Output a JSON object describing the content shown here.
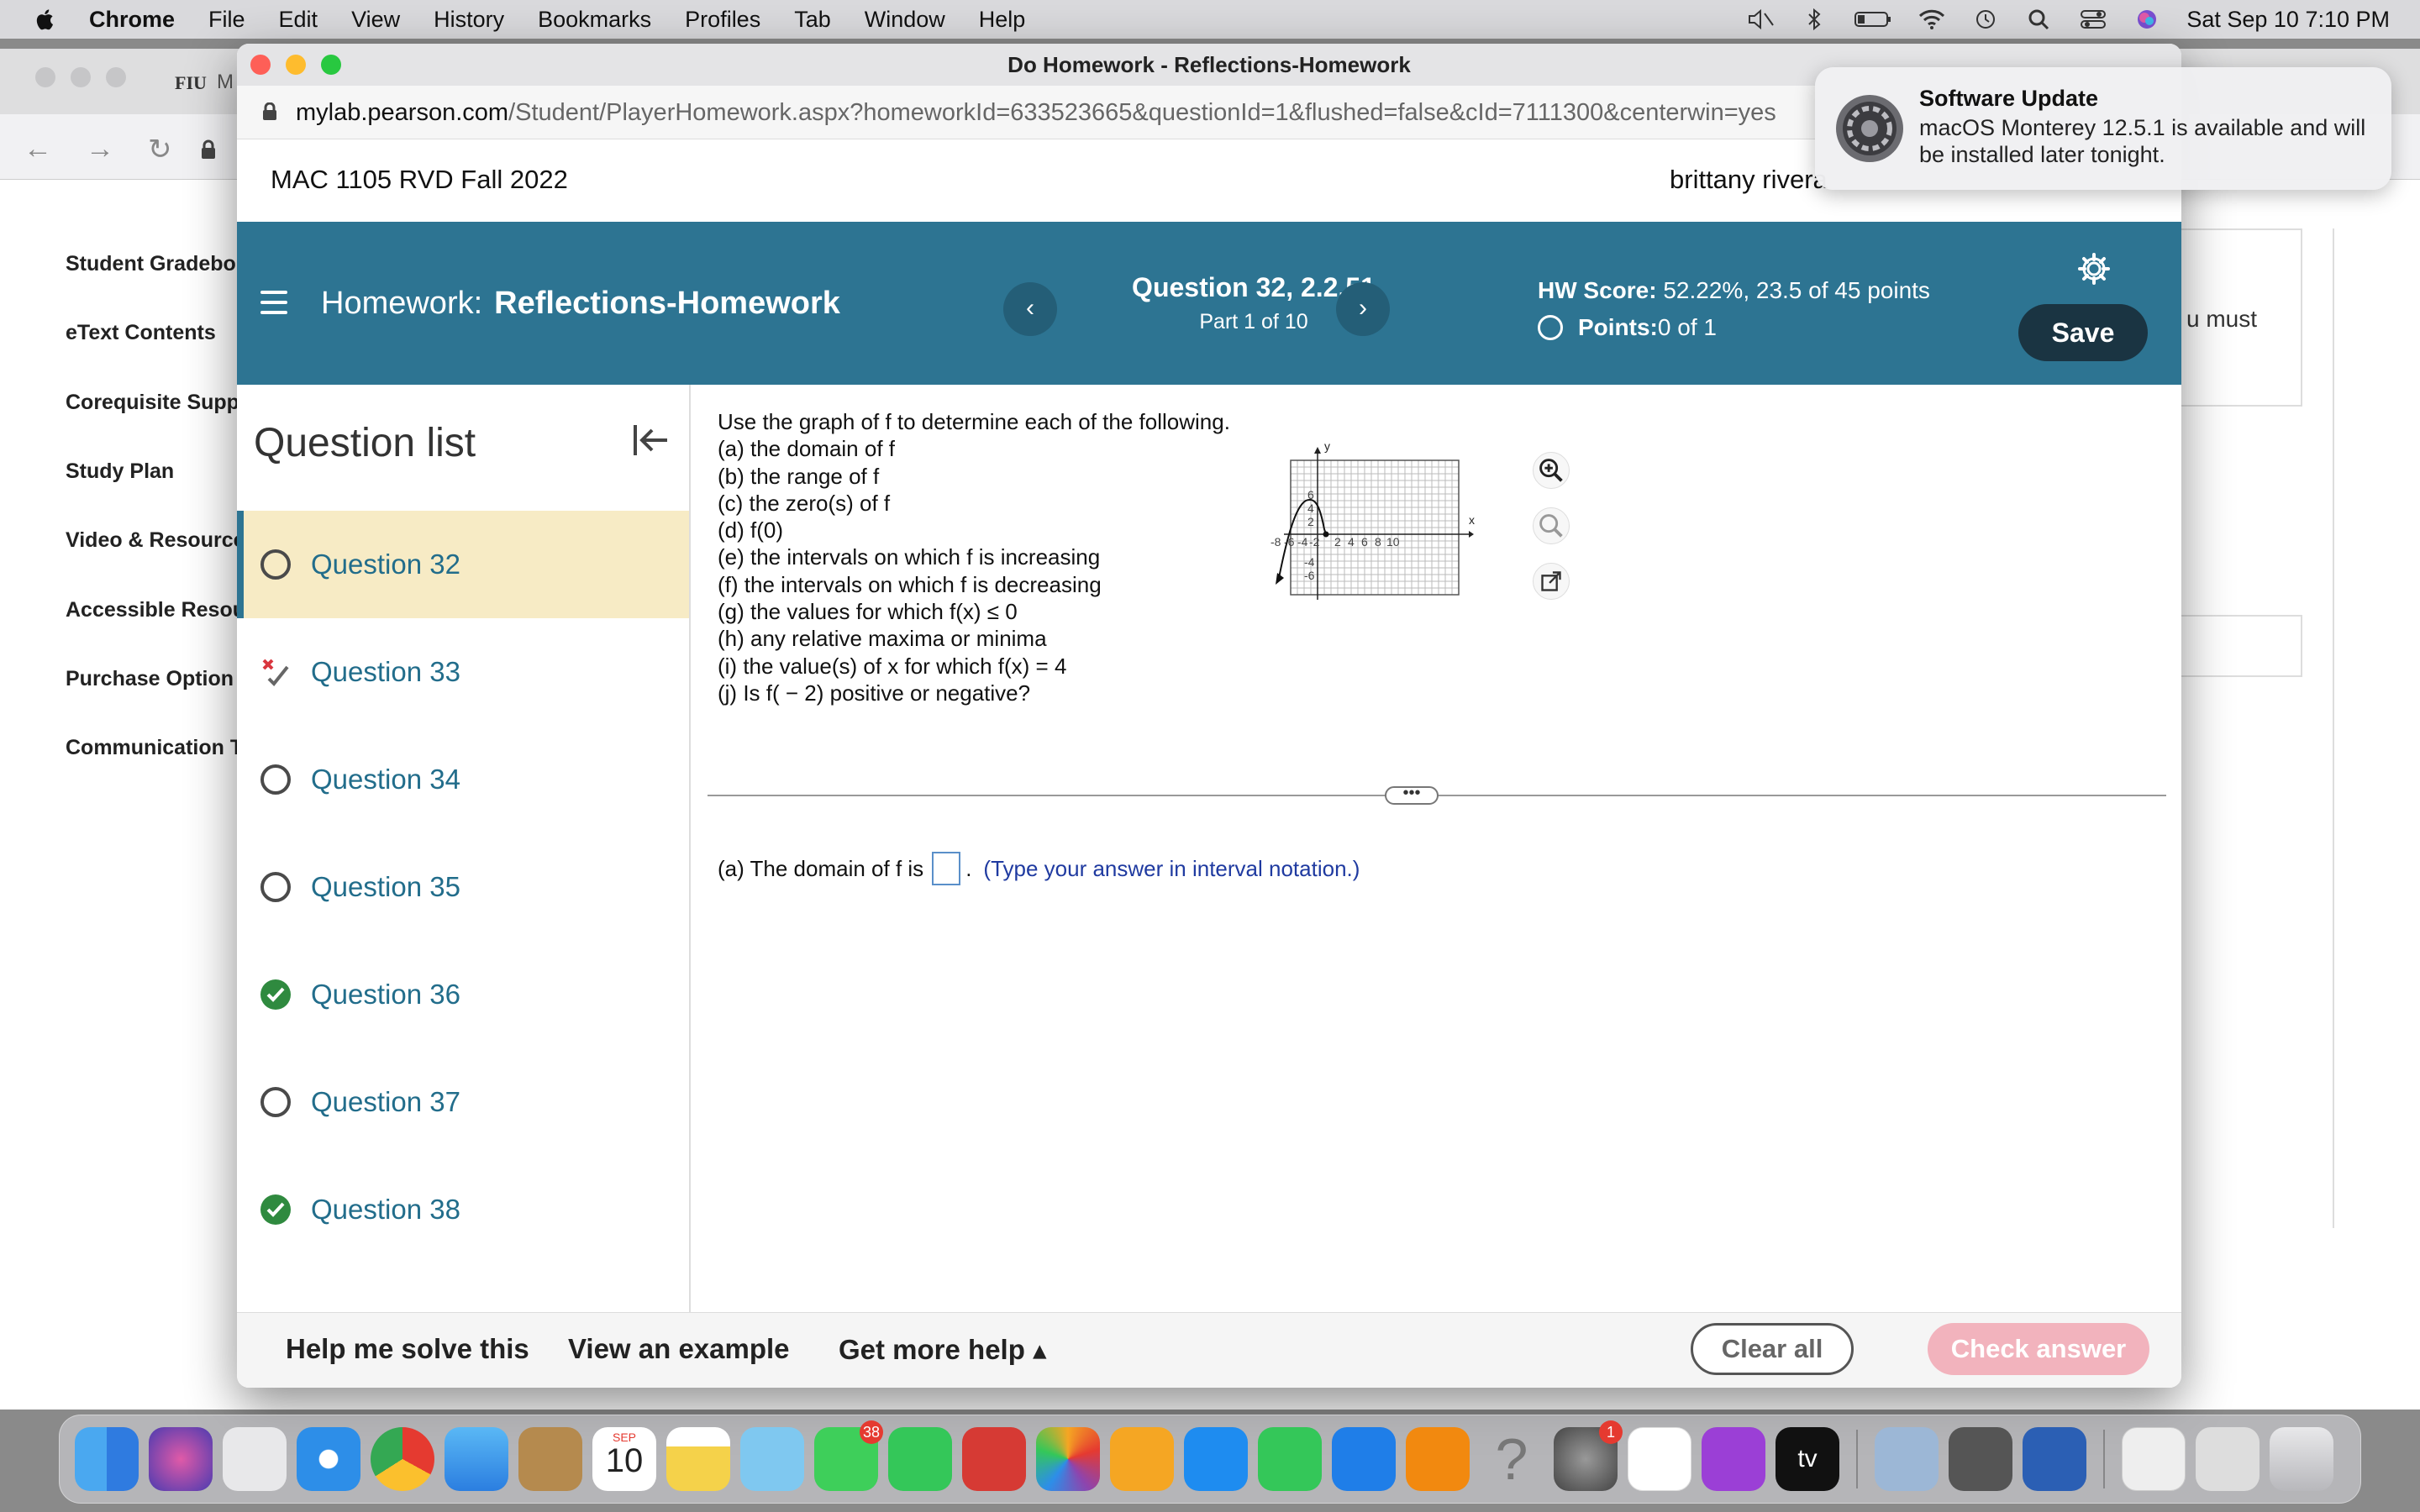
{
  "menubar": {
    "app": "Chrome",
    "items": [
      "File",
      "Edit",
      "View",
      "History",
      "Bookmarks",
      "Profiles",
      "Tab",
      "Window",
      "Help"
    ],
    "datetime": "Sat Sep 10  7:10 PM"
  },
  "background": {
    "tab_label": "FIU",
    "tab_short": "M",
    "sidebar": [
      "Student Gradebo",
      "eText Contents",
      "Corequisite Supp",
      "Study Plan",
      "Video & Resource",
      "Accessible Resou",
      "Purchase Option",
      "Communication T"
    ],
    "right_text": "u must"
  },
  "window": {
    "title": "Do Homework - Reflections-Homework",
    "url_host": "mylab.pearson.com",
    "url_path": "/Student/PlayerHomework.aspx?homeworkId=633523665&questionId=1&flushed=false&cId=7111300&centerwin=yes",
    "course": "MAC 1105 RVD Fall 2022",
    "user": "brittany rivera"
  },
  "header": {
    "prefix": "Homework:",
    "title": "Reflections-Homework",
    "question_label": "Question 32, 2.2.51",
    "part_label": "Part 1 of 10",
    "hw_score_label": "HW Score:",
    "hw_score_value": " 52.22%, 23.5 of 45 points",
    "points_label": "Points:",
    "points_value": " 0 of 1",
    "save_label": "Save",
    "prev": "‹",
    "next": "›"
  },
  "question_list": {
    "heading": "Question list",
    "items": [
      {
        "label": "Question 32",
        "status": "unanswered"
      },
      {
        "label": "Question 33",
        "status": "partial"
      },
      {
        "label": "Question 34",
        "status": "unanswered"
      },
      {
        "label": "Question 35",
        "status": "unanswered"
      },
      {
        "label": "Question 36",
        "status": "correct"
      },
      {
        "label": "Question 37",
        "status": "unanswered"
      },
      {
        "label": "Question 38",
        "status": "correct"
      }
    ]
  },
  "question": {
    "intro": "Use the graph of f to determine each of the following.",
    "parts": [
      "(a) the domain of f",
      "(b) the range of f",
      "(c) the zero(s) of f",
      "(d) f(0)",
      "(e) the intervals on which f is increasing",
      "(f) the intervals on which f is decreasing",
      "(g) the values for which f(x) ≤ 0",
      "(h) any relative maxima or minima",
      "(i) the value(s) of x for which f(x) = 4",
      "(j) Is f( − 2) positive or negative?"
    ],
    "graph": {
      "x_label": "x",
      "y_label": "y",
      "x_ticks": [
        "-8",
        "-6",
        "-4",
        "-2",
        "2",
        "4",
        "6",
        "8",
        "10"
      ],
      "y_ticks": [
        "6",
        "4",
        "2",
        "-4",
        "-6"
      ]
    },
    "answer_prefix": "(a) The domain of f is",
    "answer_suffix": ".",
    "answer_hint": "(Type your answer in interval notation.)",
    "handle": "•••"
  },
  "footer": {
    "help": "Help me solve this",
    "example": "View an example",
    "more_help": "Get more help ▴",
    "clear": "Clear all",
    "check": "Check answer"
  },
  "notification": {
    "title": "Software Update",
    "body": "macOS Monterey 12.5.1 is available and will be installed later tonight."
  },
  "dock": {
    "calendar_month": "SEP",
    "calendar_day": "10",
    "messages_badge": "38",
    "settings_badge": "1",
    "tv_label": "tv"
  },
  "colors": {
    "header_bg": "#2d7492",
    "active_item": "#f7ebc5",
    "link": "#226d8b",
    "check_disabled": "#f2b3bd"
  }
}
